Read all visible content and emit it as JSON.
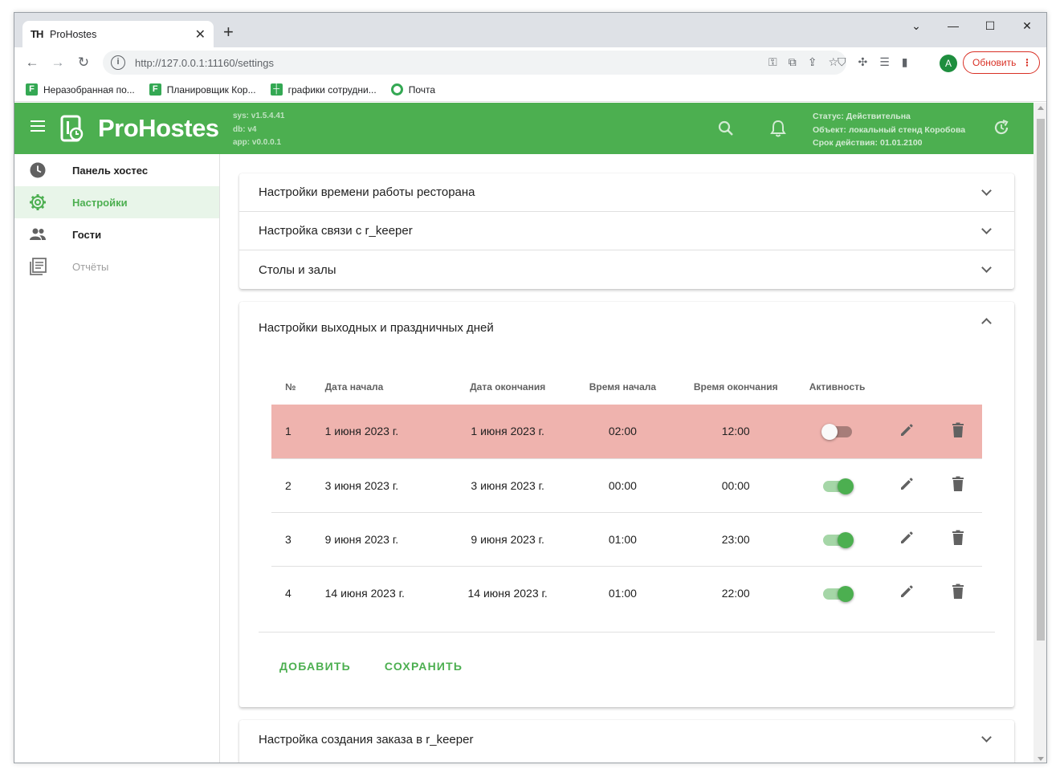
{
  "browser": {
    "tab_title": "ProHostes",
    "tab_favicon": "TH",
    "url": "http://127.0.0.1:11160/settings",
    "update_label": "Обновить",
    "avatar_letter": "A",
    "bookmarks": [
      {
        "label": "Неразобранная по...",
        "icon": "planner-icon"
      },
      {
        "label": "Планировщик Кор...",
        "icon": "planner-icon"
      },
      {
        "label": "графики сотрудни...",
        "icon": "sheets-icon"
      },
      {
        "label": "Почта",
        "icon": "mail-icon"
      }
    ]
  },
  "appbar": {
    "brand": "ProHostes",
    "sys": "sys: v1.5.4.41",
    "db": "db: v4",
    "app": "app: v0.0.0.1",
    "status": "Статус: Действительна",
    "object": "Объект: локальный стенд Коробова",
    "expires": "Срок действия: 01.01.2100",
    "color": "#4caf50"
  },
  "sidebar": {
    "items": [
      {
        "label": "Панель хостес",
        "icon": "clock-icon",
        "state": "normal"
      },
      {
        "label": "Настройки",
        "icon": "gear-icon",
        "state": "active"
      },
      {
        "label": "Гости",
        "icon": "people-icon",
        "state": "normal"
      },
      {
        "label": "Отчёты",
        "icon": "reports-icon",
        "state": "disabled"
      }
    ]
  },
  "settings": {
    "collapsed_panels": [
      "Настройки времени работы ресторана",
      "Настройка связи с r_keeper",
      "Столы и залы"
    ],
    "open_panel": {
      "title": "Настройки выходных и праздничных дней",
      "columns": [
        "№",
        "Дата начала",
        "Дата окончания",
        "Время начала",
        "Время окончания",
        "Активность"
      ],
      "rows": [
        {
          "no": "1",
          "start_date": "1 июня 2023 г.",
          "end_date": "1 июня 2023 г.",
          "start_time": "02:00",
          "end_time": "12:00",
          "active": false
        },
        {
          "no": "2",
          "start_date": "3 июня 2023 г.",
          "end_date": "3 июня 2023 г.",
          "start_time": "00:00",
          "end_time": "00:00",
          "active": true
        },
        {
          "no": "3",
          "start_date": "9 июня 2023 г.",
          "end_date": "9 июня 2023 г.",
          "start_time": "01:00",
          "end_time": "23:00",
          "active": true
        },
        {
          "no": "4",
          "start_date": "14 июня 2023 г.",
          "end_date": "14 июня 2023 г.",
          "start_time": "01:00",
          "end_time": "22:00",
          "active": true
        }
      ],
      "add_label": "ДОБАВИТЬ",
      "save_label": "СОХРАНИТЬ"
    },
    "last_panel": "Настройка создания заказа в r_keeper",
    "inactive_row_color": "#efb3ae"
  }
}
